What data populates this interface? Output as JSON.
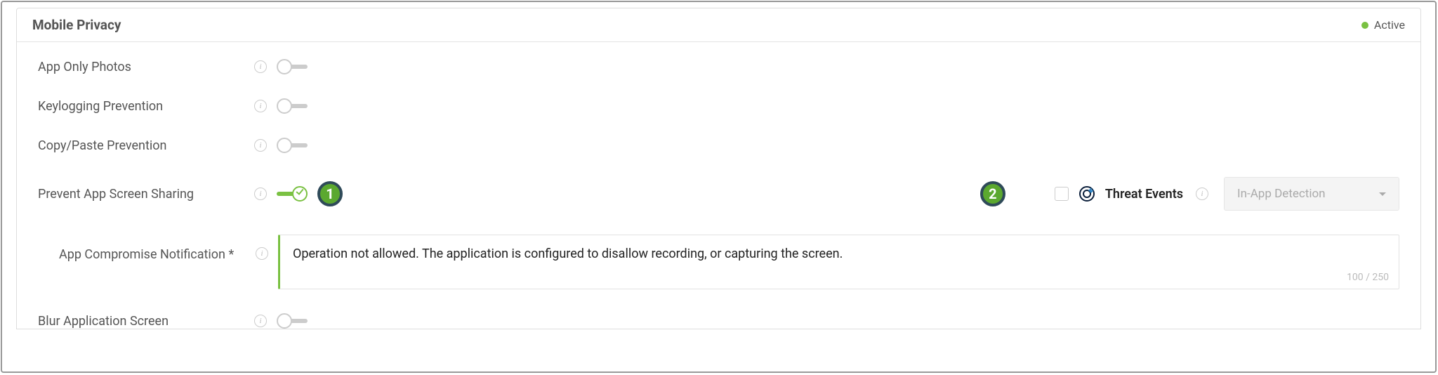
{
  "panel": {
    "title": "Mobile Privacy",
    "status_label": "Active"
  },
  "rows": {
    "app_only_photos": "App Only Photos",
    "keylogging": "Keylogging Prevention",
    "copypaste": "Copy/Paste Prevention",
    "prevent_screen": "Prevent App Screen Sharing",
    "blur": "Blur Application Screen"
  },
  "sub": {
    "notif_label": "App Compromise Notification *",
    "notif_text": "Operation not allowed. The application is configured to disallow recording, or capturing the screen.",
    "counter": "100 / 250"
  },
  "threat": {
    "label": "Threat Events",
    "dropdown": "In-App Detection"
  },
  "callouts": {
    "one": "1",
    "two": "2"
  }
}
